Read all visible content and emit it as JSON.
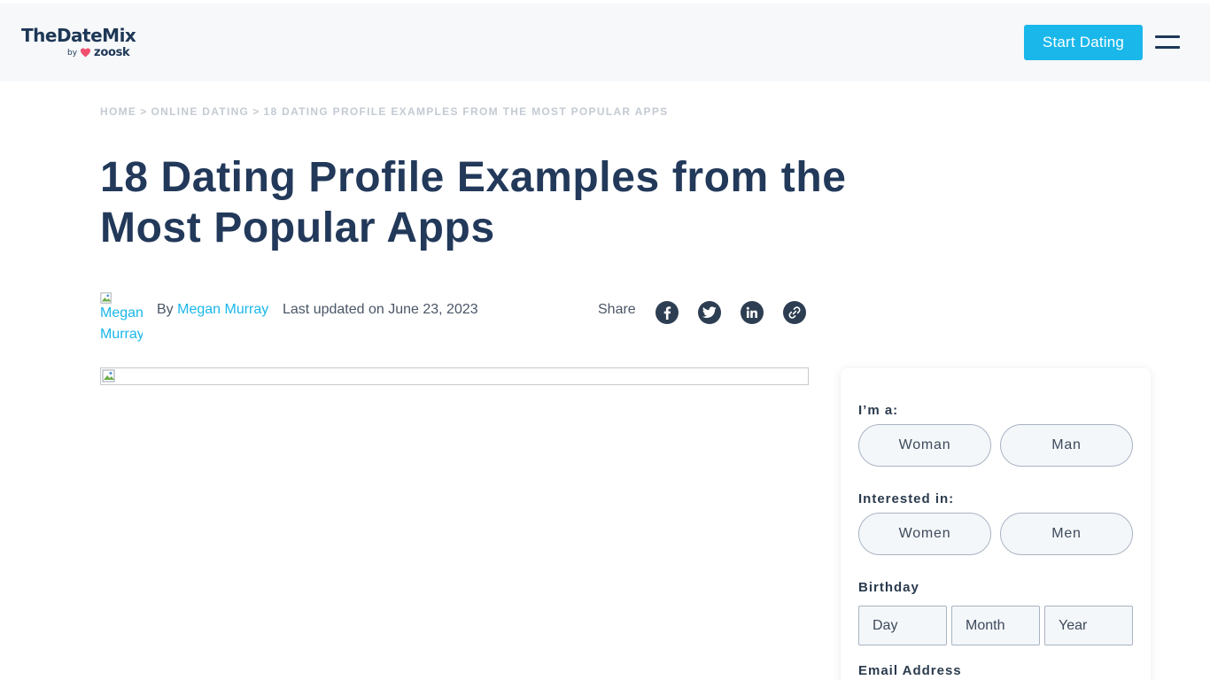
{
  "header": {
    "logo_main": "TheDateMix",
    "logo_by": "by",
    "logo_brand": "zoosk",
    "cta_label": "Start Dating",
    "brand_color": "#1e3756",
    "accent_color": "#1ab7ea",
    "heart_color": "#f0506e"
  },
  "breadcrumb": {
    "items": [
      "HOME",
      "ONLINE DATING",
      "18 DATING PROFILE EXAMPLES FROM THE MOST POPULAR APPS"
    ],
    "separator": ">"
  },
  "article": {
    "title": "18 Dating Profile Examples from the Most Popular Apps",
    "avatar_alt": "Megan\nMurray",
    "by_label": "By",
    "author": "Megan Murray",
    "updated": "Last updated on June 23, 2023",
    "share_label": "Share",
    "share_icons": [
      "facebook-icon",
      "twitter-icon",
      "linkedin-icon",
      "link-icon"
    ]
  },
  "signup": {
    "gender_label": "I’m a:",
    "gender_options": [
      "Woman",
      "Man"
    ],
    "interest_label": "Interested in:",
    "interest_options": [
      "Women",
      "Men"
    ],
    "birthday_label": "Birthday",
    "birthday_placeholders": [
      "Day",
      "Month",
      "Year"
    ],
    "email_label": "Email Address"
  }
}
